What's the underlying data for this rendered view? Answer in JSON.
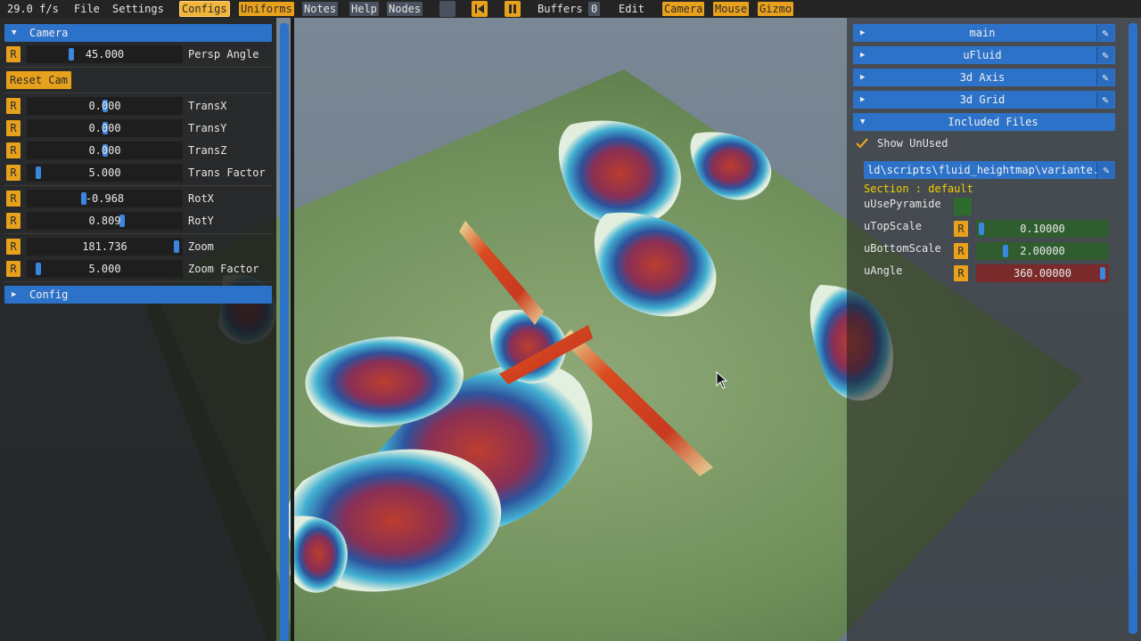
{
  "menubar": {
    "fps": "29.0 f/s",
    "file": "File",
    "settings": "Settings",
    "configs": "Configs",
    "uniforms": "Uniforms",
    "notes": "Notes",
    "help": "Help",
    "nodes": "Nodes",
    "buffers": "Buffers",
    "buffers_count": "0",
    "edit": "Edit",
    "camera": "Camera",
    "mouse": "Mouse",
    "gizmo": "Gizmo"
  },
  "left": {
    "camera_header": "Camera",
    "reset_label": "R",
    "persp": {
      "value": "45.000",
      "label": "Persp Angle",
      "fraction": 0.27
    },
    "reset_cam": "Reset Cam",
    "rows": [
      {
        "value": "0.000",
        "label": "TransX",
        "fraction": 0.5
      },
      {
        "value": "0.000",
        "label": "TransY",
        "fraction": 0.5
      },
      {
        "value": "0.000",
        "label": "TransZ",
        "fraction": 0.5
      },
      {
        "value": "5.000",
        "label": "Trans Factor",
        "fraction": 0.05
      },
      {
        "value": "-0.968",
        "label": "RotX",
        "fraction": 0.36
      },
      {
        "value": "0.809",
        "label": "RotY",
        "fraction": 0.62
      },
      {
        "value": "181.736",
        "label": "Zoom",
        "fraction": 0.99
      },
      {
        "value": "5.000",
        "label": "Zoom Factor",
        "fraction": 0.05
      }
    ],
    "config_header": "Config"
  },
  "right": {
    "headers": [
      "main",
      "uFluid",
      "3d Axis",
      "3d Grid"
    ],
    "included_files": "Included Files",
    "show_unused": "Show UnUsed",
    "file_path": "ld\\scripts\\fluid_heightmap\\variante.",
    "section": "Section : default",
    "uniforms": {
      "use_pyramide": "uUsePyramide",
      "top_scale": {
        "label": "uTopScale",
        "value": "0.10000",
        "fraction": 0.0
      },
      "bottom_scale": {
        "label": "uBottomScale",
        "value": "2.00000",
        "fraction": 0.2
      },
      "angle": {
        "label": "uAngle",
        "value": "360.00000",
        "fraction": 1.0
      }
    },
    "reset_label": "R"
  },
  "colors": {
    "accent_blue": "#2d72c9",
    "accent_orange": "#e8a11d",
    "checkbox_green": "#2f6b2f",
    "angle_red": "#7a2a2a",
    "section_yellow": "#f2d000"
  }
}
